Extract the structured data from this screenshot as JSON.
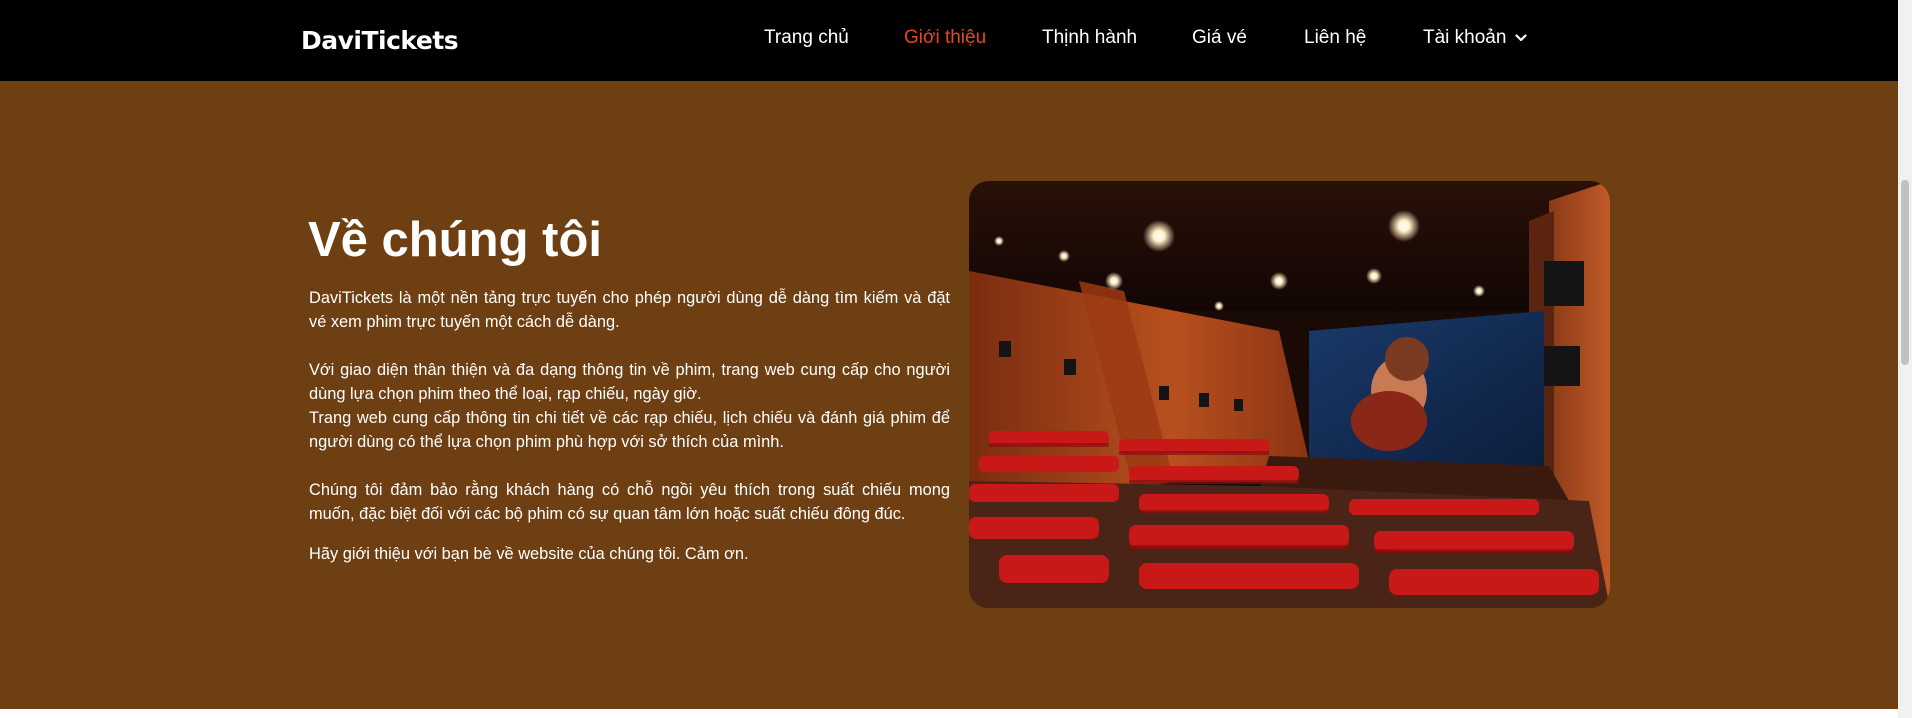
{
  "header": {
    "logo": "DaviTickets",
    "nav": [
      {
        "label": "Trang chủ",
        "active": false
      },
      {
        "label": "Giới thiệu",
        "active": true
      },
      {
        "label": "Thịnh hành",
        "active": false
      },
      {
        "label": "Giá vé",
        "active": false
      },
      {
        "label": "Liên hệ",
        "active": false
      },
      {
        "label": "Tài khoản",
        "active": false,
        "dropdown": true
      }
    ]
  },
  "about": {
    "title": "Về chúng tôi",
    "paragraphs": [
      "DaviTickets là một nền tảng trực tuyến cho phép người dùng dễ dàng tìm kiếm và đặt vé xem phim trực tuyến một cách dễ dàng.",
      "Với giao diện thân thiện và đa dạng thông tin về phim, trang web cung cấp cho người dùng lựa chọn phim theo thể loại, rạp chiếu, ngày giờ.",
      "Trang web cung cấp thông tin chi tiết về các rạp chiếu, lịch chiếu và đánh giá phim để người dùng có thể lựa chọn phim phù hợp với sở thích của mình.",
      "Chúng tôi đảm bảo rằng khách hàng có chỗ ngồi yêu thích trong suất chiếu mong muốn, đặc biệt đối với các bộ phim có sự quan tâm lớn hoặc suất chiếu đông đúc.",
      "Hãy giới thiệu với bạn bè về website của chúng tôi. Cảm ơn."
    ]
  },
  "colors": {
    "navbar_bg": "#000000",
    "section_bg": "#6e3f12",
    "active_nav": "#e8461e",
    "text": "#ffffff"
  },
  "icons": {
    "dropdown": "chevron-down-icon"
  }
}
